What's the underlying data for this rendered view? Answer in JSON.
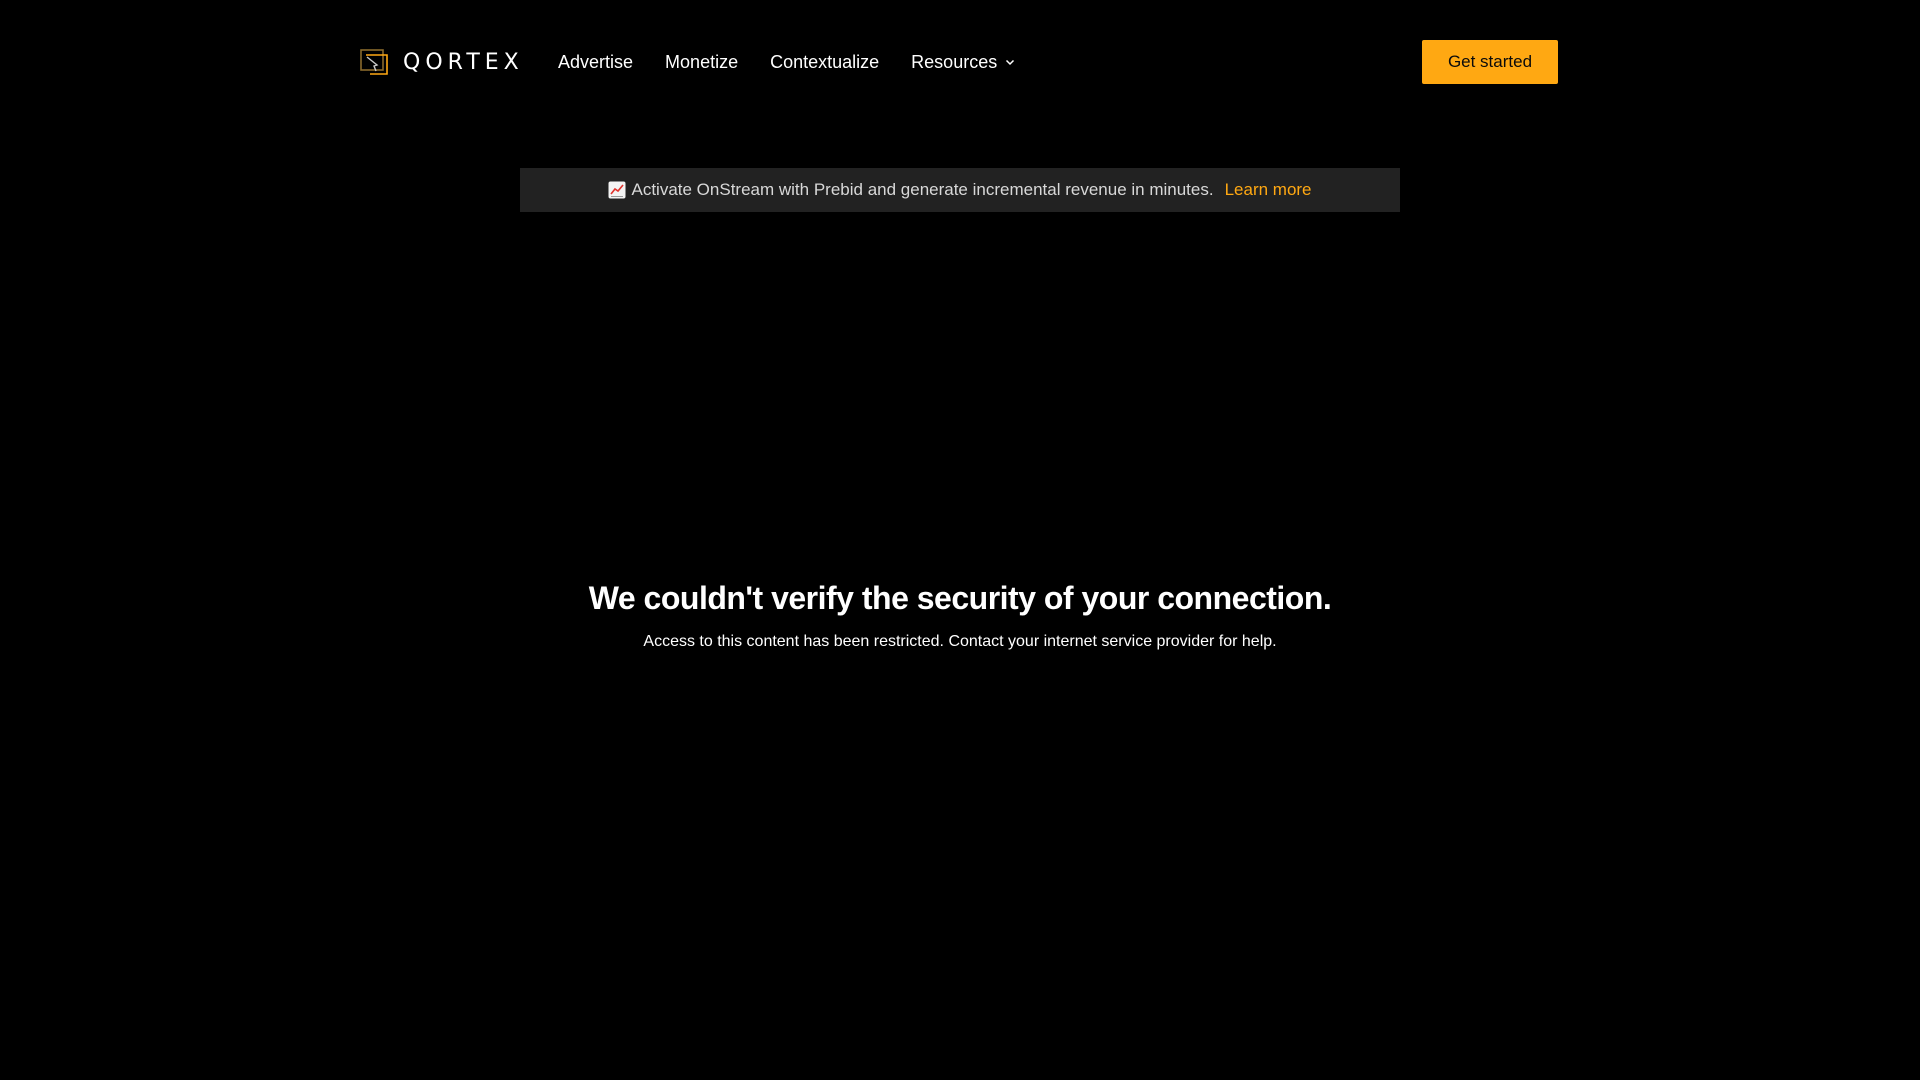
{
  "brand": {
    "name": "QORTEX",
    "accent_color": "#ffa812",
    "logo_icon": "qortex-logo-mark"
  },
  "nav": {
    "items": [
      {
        "label": "Advertise"
      },
      {
        "label": "Monetize"
      },
      {
        "label": "Contextualize"
      },
      {
        "label": "Resources",
        "icon": "chevron-down-icon"
      }
    ],
    "cta_label": "Get started"
  },
  "banner": {
    "emoji_icon": "chart-increasing-icon",
    "text": "Activate OnStream with Prebid and generate incremental revenue in minutes.",
    "link_label": "Learn more",
    "background": "#222222"
  },
  "message": {
    "title": "We couldn't verify the security of your connection.",
    "subtitle": "Access to this content has been restricted. Contact your internet service provider for help."
  }
}
